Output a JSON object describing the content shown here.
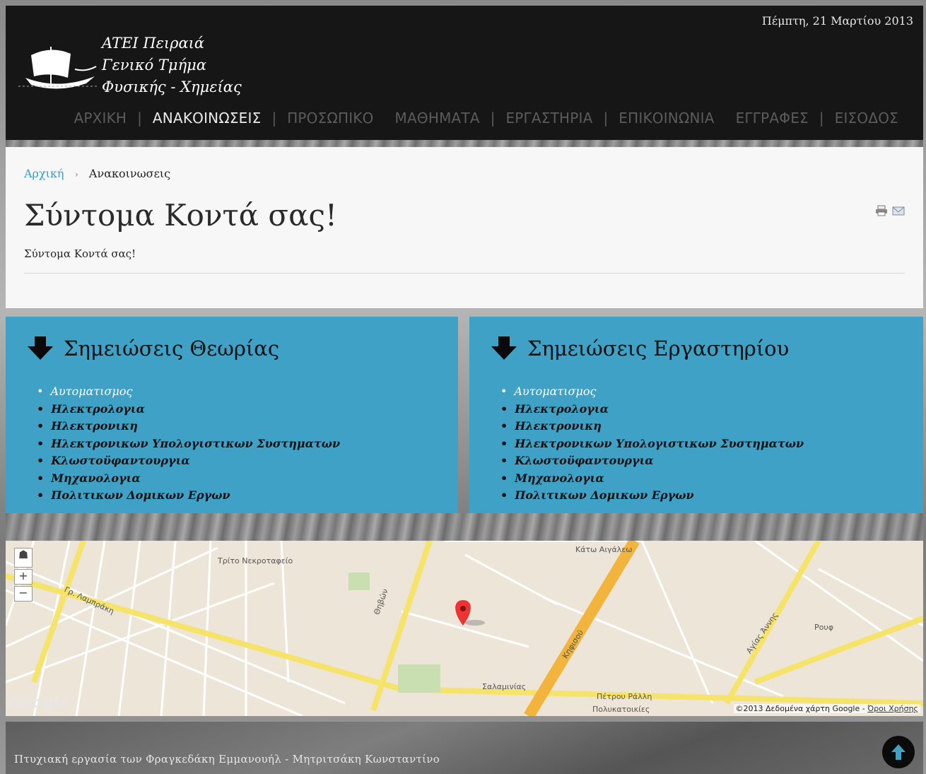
{
  "header": {
    "logo_lines": [
      "ATEI Πειραιά",
      "Γενικό Τμήμα",
      "Φυσικής - Χημείας"
    ],
    "date": "Πέμπτη, 21 Μαρτίου 2013",
    "nav": [
      {
        "label": "ΑΡΧΙΚΗ",
        "active": false
      },
      {
        "label": "ΑΝΑΚΟΙΝΩΣΕΙΣ",
        "active": true
      },
      {
        "label": "ΠΡΟΣΩΠΙΚΟ",
        "active": false
      },
      {
        "label": "ΜΑΘΗΜΑΤΑ",
        "active": false
      },
      {
        "label": "ΕΡΓΑΣΤΗΡΙΑ",
        "active": false
      },
      {
        "label": "ΕΠΙΚΟΙΝΩΝΙΑ",
        "active": false
      },
      {
        "label": "ΕΓΓΡΑΦΕΣ",
        "active": false
      },
      {
        "label": "ΕΙΣΟΔΟΣ",
        "active": false
      }
    ]
  },
  "breadcrumb": {
    "home": "Αρχική",
    "current": "Ανακοινωσεις"
  },
  "article": {
    "title": "Σύντομα Κοντά σας!",
    "body": "Σύντομα Κοντά σας!",
    "tools": [
      "print-icon",
      "email-icon"
    ]
  },
  "theory": {
    "title": "Σημειώσεις Θεωρίας",
    "items": [
      "Αυτοματισμος",
      "Ηλεκτρολογια",
      "Ηλεκτρονικη",
      "Ηλεκτρονικων Υπολογιστικων Συστηματων",
      "Κλωστοϋφαντουργια",
      "Μηχανολογια",
      "Πολιτικων Δομικων Εργων"
    ]
  },
  "lab": {
    "title": "Σημειώσεις Εργαστηρίου",
    "items": [
      "Αυτοματισμος",
      "Ηλεκτρολογια",
      "Ηλεκτρονικη",
      "Ηλεκτρονικων Υπολογιστικων Συστηματων",
      "Κλωστοϋφαντουργια",
      "Μηχανολογια",
      "Πολιτικων Δομικων Εργων"
    ]
  },
  "map": {
    "labels": [
      "Τρίτο Νεκροταφείο",
      "Κάτω Αιγάλεω",
      "Γρ. Λαμπράκη",
      "Πέτρου Ράλλη",
      "Σαλαμινίας",
      "Πολυκατοικίες",
      "Ρουφ",
      "Θηβών",
      "Κηφισού",
      "Αγίας Άννης"
    ],
    "logo": "Google",
    "attribution": "©2013 Δεδομένα χάρτη Google - ",
    "terms": "Όροι Χρήσης"
  },
  "footer": {
    "text": "Πτυχιακή εργασία των Φραγκεδάκη Εμμανουήλ - Μητριτσάκη Κωνσταντίνο"
  },
  "colors": {
    "accent": "#3fa1c6",
    "header": "#161616",
    "link": "#3a9cc6"
  }
}
